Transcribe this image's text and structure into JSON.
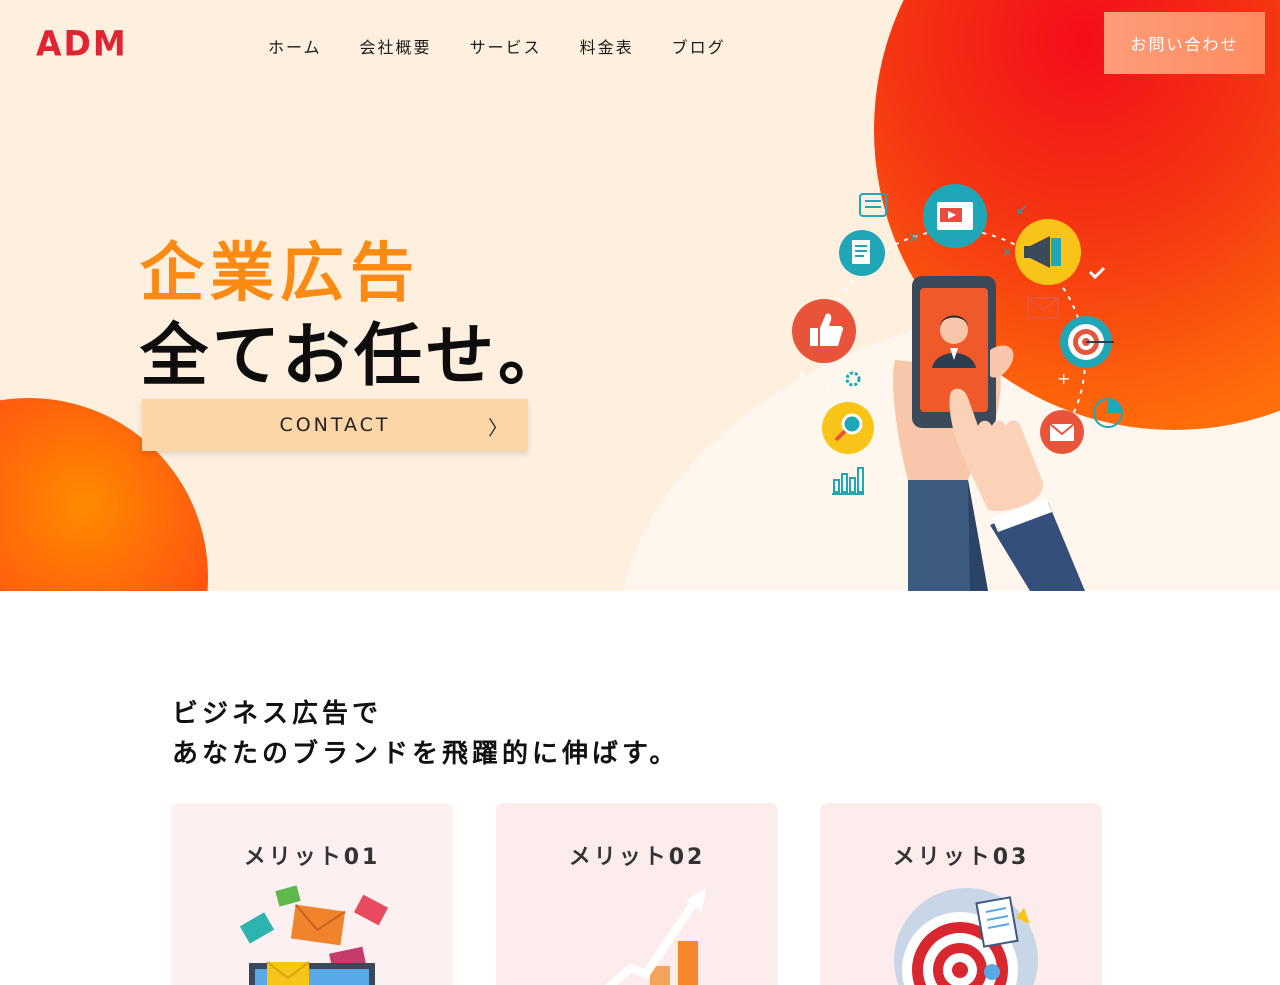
{
  "header": {
    "logo": "ADM",
    "nav": [
      "ホーム",
      "会社概要",
      "サービス",
      "料金表",
      "ブログ"
    ],
    "contact_button": "お問い合わせ"
  },
  "hero": {
    "headline_line1": "企業広告",
    "headline_line2": "全てお任せ。",
    "cta_label": "CONTACT",
    "cta_arrow": "〉"
  },
  "intro": {
    "title_line1": "ビジネス広告で",
    "title_line2": "あなたのブランドを飛躍的に伸ばす。"
  },
  "merits": [
    {
      "title": "メリット01"
    },
    {
      "title": "メリット02"
    },
    {
      "title": "メリット03"
    }
  ],
  "colors": {
    "accent_orange": "#fb8a12",
    "logo_red": "#e02431",
    "hero_bg": "#feefdf",
    "cta_bg": "#fdd6a8",
    "contact_btn": "#fd9c7a"
  }
}
